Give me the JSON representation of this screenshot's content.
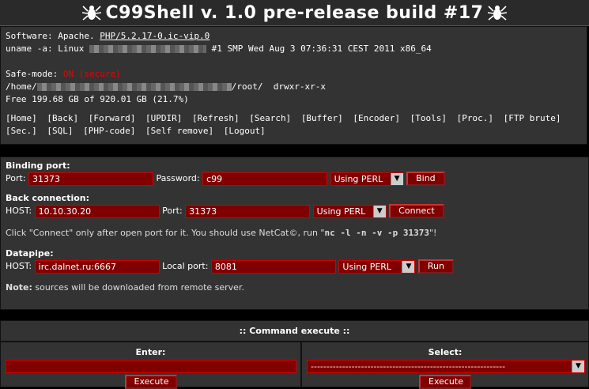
{
  "header": {
    "title": "C99Shell v. 1.0 pre-release build #17"
  },
  "info": {
    "software_label": "Software: Apache.",
    "php_link": "PHP/5.2.17-0.ic-vip.0",
    "uname_label": "uname -a: Linux",
    "uname_rest": "#1 SMP Wed Aug 3 07:36:31 CEST 2011 x86_64",
    "safemode_label": "Safe-mode:",
    "safemode_value": "ON (secure)",
    "path_prefix": "/home/",
    "path_suffix": "/root/",
    "perms": "drwxr-xr-x",
    "free": "Free 199.68 GB of 920.01 GB (21.7%)"
  },
  "nav": [
    "[Home]",
    "[Back]",
    "[Forward]",
    "[UPDIR]",
    "[Refresh]",
    "[Search]",
    "[Buffer]",
    "[Encoder]",
    "[Tools]",
    "[Proc.]",
    "[FTP brute]",
    "[Sec.]",
    "[SQL]",
    "[PHP-code]",
    "[Self remove]",
    "[Logout]"
  ],
  "binding": {
    "title": "Binding port:",
    "port_label": "Port:",
    "port_value": "31373",
    "password_label": "Password:",
    "password_value": "c99",
    "method": "Using PERL",
    "button": "Bind"
  },
  "back": {
    "title": "Back connection:",
    "host_label": "HOST:",
    "host_value": "10.10.30.20",
    "port_label": "Port:",
    "port_value": "31373",
    "method": "Using PERL",
    "button": "Connect",
    "hint_pre": "Click \"Connect\" only after open port for it. You should use NetCat©, run \"",
    "hint_cmd": "nc -l -n -v -p 31373",
    "hint_post": "\"!"
  },
  "datapipe": {
    "title": "Datapipe:",
    "host_label": "HOST:",
    "host_value": "irc.dalnet.ru:6667",
    "local_label": "Local port:",
    "local_value": "8081",
    "method": "Using PERL",
    "button": "Run"
  },
  "note": {
    "bold": "Note:",
    "text": " sources will be downloaded from remote server."
  },
  "command": {
    "title": ":: Command execute ::",
    "enter_label": "Enter:",
    "select_label": "Select:",
    "select_value": "--------------------------------------------------------------",
    "execute": "Execute"
  },
  "colors": {
    "accent": "#800000",
    "panel": "#333333",
    "warning": "#ee0000"
  }
}
